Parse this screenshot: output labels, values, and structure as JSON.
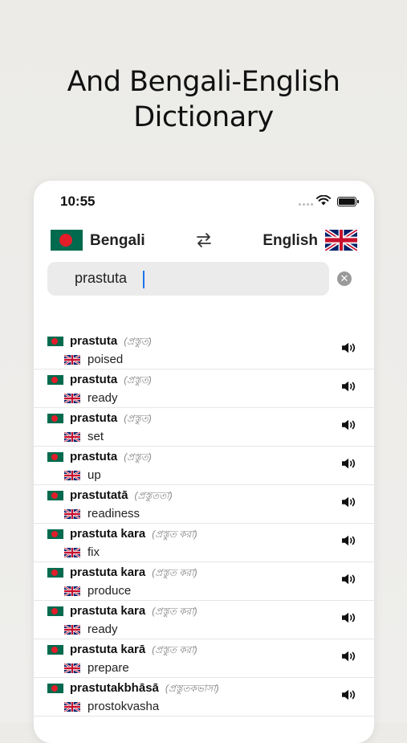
{
  "promo": {
    "line1": "And Bengali-English",
    "line2": "Dictionary"
  },
  "status_bar": {
    "time": "10:55"
  },
  "language_bar": {
    "from_label": "Bengali",
    "to_label": "English",
    "from_flag": "bangladesh-flag-icon",
    "to_flag": "uk-flag-icon",
    "swap_icon": "swap-arrows-icon"
  },
  "search": {
    "value": "prastuta",
    "clear_icon": "clear-x-icon"
  },
  "colors": {
    "bd_green": "#006a4e",
    "bd_red": "#e21d2a",
    "caret": "#1a73e8"
  },
  "results": [
    {
      "word": "prastuta",
      "native": "(প্রস্তুত)",
      "translation": "poised"
    },
    {
      "word": "prastuta",
      "native": "(প্রস্তুত)",
      "translation": "ready"
    },
    {
      "word": "prastuta",
      "native": "(প্রস্তুত)",
      "translation": "set"
    },
    {
      "word": "prastuta",
      "native": "(প্রস্তুত)",
      "translation": "up"
    },
    {
      "word": "prastutatā",
      "native": "(প্রস্তুততা)",
      "translation": "readiness"
    },
    {
      "word": "prastuta kara",
      "native": "(প্রস্তুত করা)",
      "translation": "fix"
    },
    {
      "word": "prastuta kara",
      "native": "(প্রস্তুত করা)",
      "translation": "produce"
    },
    {
      "word": "prastuta kara",
      "native": "(প্রস্তুত করা)",
      "translation": "ready"
    },
    {
      "word": "prastuta karā",
      "native": "(প্রস্তুত করা)",
      "translation": "prepare"
    },
    {
      "word": "prastutakbhāsā",
      "native": "(প্রস্তুতকভাসা)",
      "translation": "prostokvasha"
    }
  ]
}
